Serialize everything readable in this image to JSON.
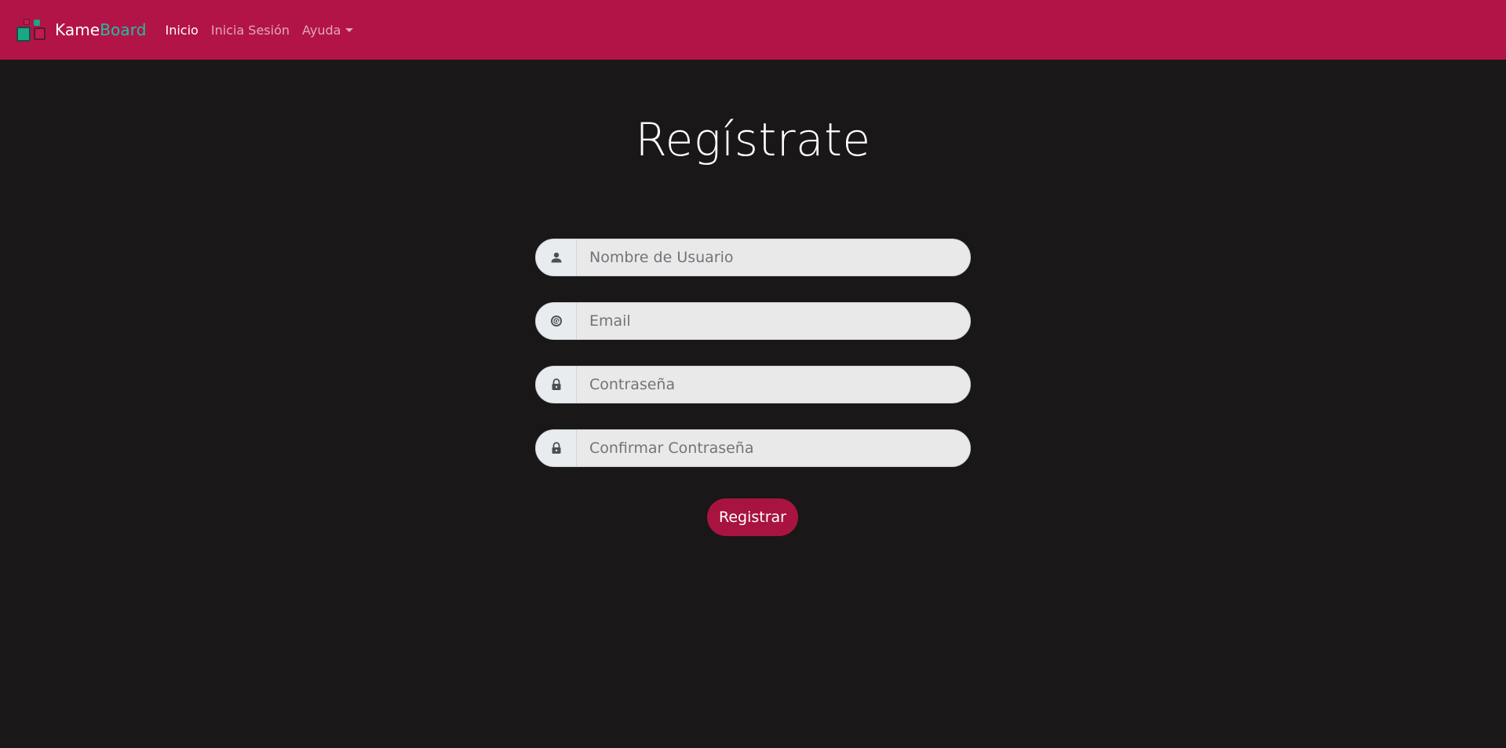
{
  "navbar": {
    "brand_primary": "Kame",
    "brand_accent": "Board",
    "links": [
      {
        "label": "Inicio",
        "active": true
      },
      {
        "label": "Inicia Sesión",
        "active": false
      },
      {
        "label": "Ayuda",
        "active": false,
        "dropdown": true
      }
    ],
    "background_color": "#b31448"
  },
  "page": {
    "title": "Regístrate",
    "background_color": "#1a1718"
  },
  "form": {
    "username": {
      "placeholder": "Nombre de Usuario",
      "value": "",
      "icon": "user-icon"
    },
    "email": {
      "placeholder": "Email",
      "value": "",
      "icon": "at-sign-icon"
    },
    "password": {
      "placeholder": "Contraseña",
      "value": "",
      "icon": "lock-icon"
    },
    "confirm_password": {
      "placeholder": "Confirmar Contraseña",
      "value": "",
      "icon": "lock-icon"
    },
    "submit_label": "Registrar",
    "accent_color": "#a8143f"
  }
}
